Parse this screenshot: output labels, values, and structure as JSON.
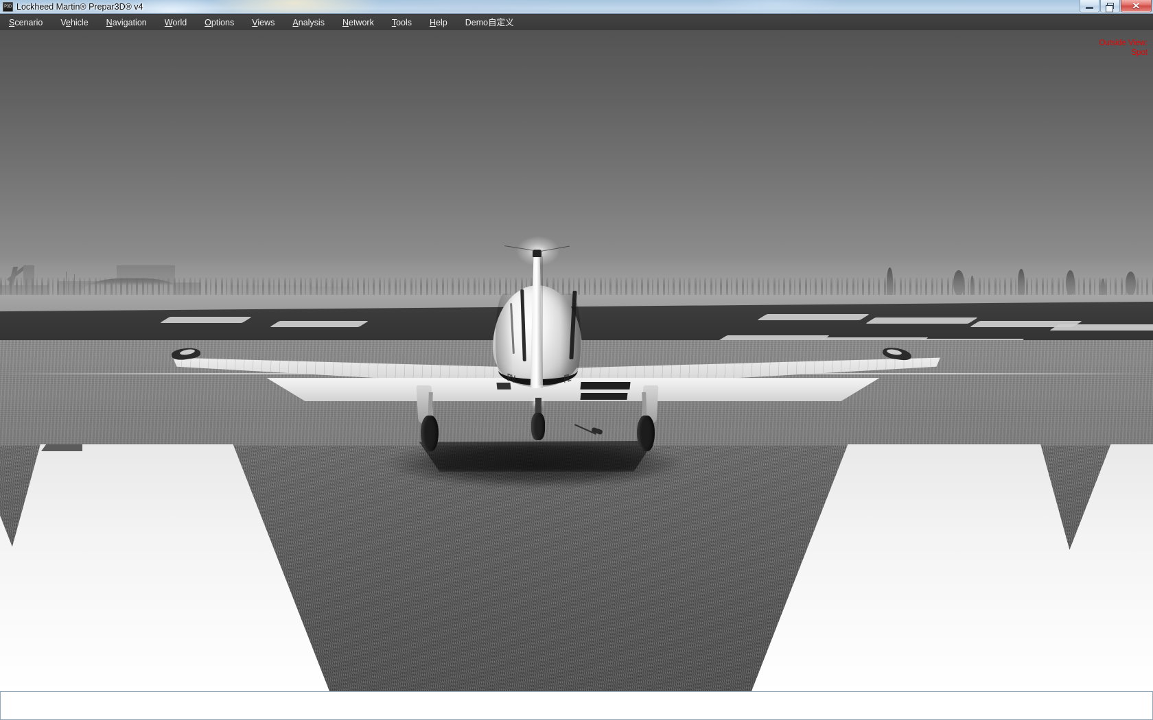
{
  "window": {
    "title": "Lockheed Martin® Prepar3D® v4",
    "app_icon": "P3D",
    "icon_label": "p3d-app-icon",
    "controls": {
      "minimize": "minimize-button",
      "restore": "restore-button",
      "close": "close-button",
      "close_glyph": "✕"
    }
  },
  "menu": {
    "items": [
      {
        "label": "Scenario",
        "mnemonic": "S"
      },
      {
        "label": "Vehicle",
        "mnemonic": "e"
      },
      {
        "label": "Navigation",
        "mnemonic": "N"
      },
      {
        "label": "World",
        "mnemonic": "W"
      },
      {
        "label": "Options",
        "mnemonic": "O"
      },
      {
        "label": "Views",
        "mnemonic": "V"
      },
      {
        "label": "Analysis",
        "mnemonic": "A"
      },
      {
        "label": "Network",
        "mnemonic": "N"
      },
      {
        "label": "Tools",
        "mnemonic": "T"
      },
      {
        "label": "Help",
        "mnemonic": "H"
      },
      {
        "label": "Demo自定义",
        "mnemonic": ""
      }
    ]
  },
  "viewport": {
    "overlay": {
      "line1": "Outside View:",
      "line2": "Spot",
      "color": "#ee0000"
    },
    "scene": {
      "description": "rear view of single-engine light aircraft on runway",
      "registration_left": "PV",
      "registration_right": "FL"
    }
  },
  "status_bar": {
    "text": ""
  },
  "colors": {
    "menu_bg": "#3e3e3e",
    "menu_text": "#f0f0f0",
    "title_glass": "#b7d0e6",
    "overlay_red": "#ee0000",
    "sky_top": "#535353",
    "sky_horizon": "#979797",
    "runway_dark": "#555555",
    "marking_white": "#fafafa",
    "status_bg": "#ffffff"
  }
}
